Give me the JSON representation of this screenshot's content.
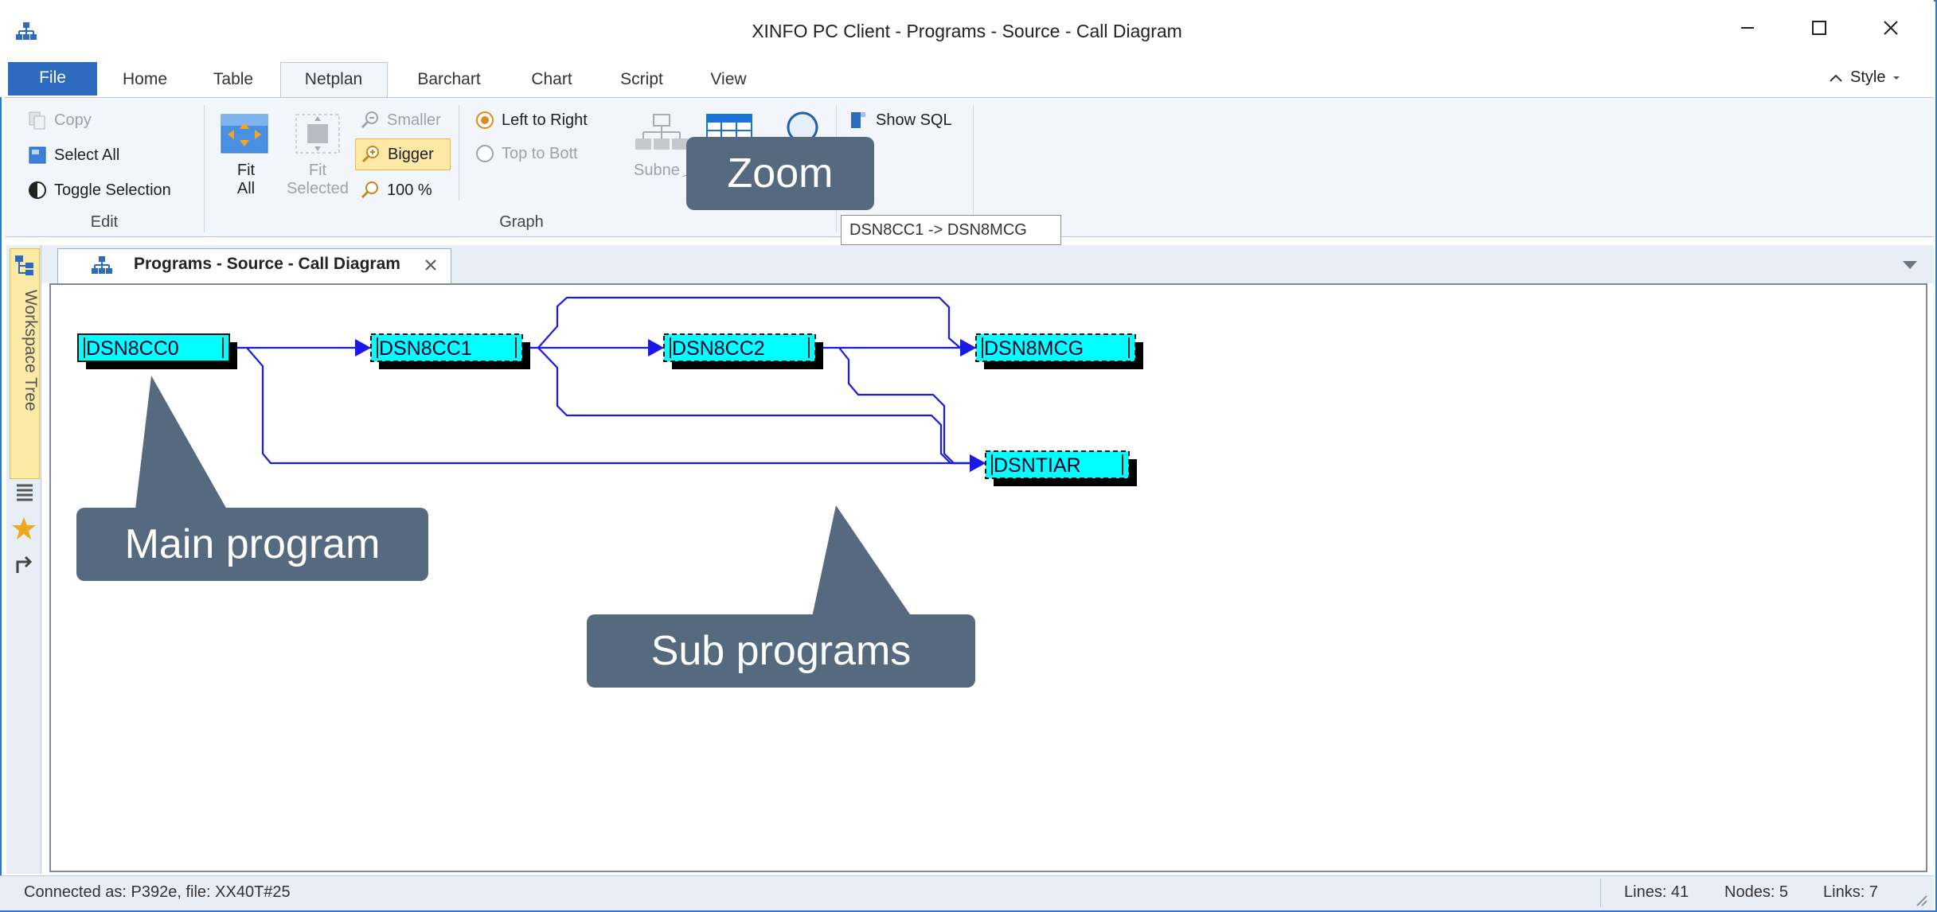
{
  "window": {
    "title": "XINFO PC Client - Programs - Source - Call Diagram"
  },
  "ribbon_tabs": [
    "File",
    "Home",
    "Table",
    "Netplan",
    "Barchart",
    "Chart",
    "Script",
    "View"
  ],
  "style_button": "Style",
  "ribbon": {
    "edit": {
      "copy": "Copy",
      "select_all": "Select All",
      "toggle_selection": "Toggle Selection",
      "label": "Edit"
    },
    "graph": {
      "fit_all_1": "Fit",
      "fit_all_2": "All",
      "fit_selected_1": "Fit",
      "fit_selected_2": "Selected",
      "smaller": "Smaller",
      "bigger": "Bigger",
      "zoom_100": "100 %",
      "left_to_right": "Left to Right",
      "top_to_bottom": "Top to Bott",
      "subnet": "Subne",
      "label": "Graph"
    },
    "show_sql": "Show SQL"
  },
  "tooltip": "DSN8CC1 -> DSN8MCG",
  "callouts": {
    "zoom": "Zoom",
    "main_program": "Main program",
    "sub_programs": "Sub programs"
  },
  "sidebar": {
    "workspace_tree": "Workspace Tree"
  },
  "document_tab": {
    "title": "Programs - Source - Call Diagram"
  },
  "diagram": {
    "nodes": [
      {
        "id": "DSN8CC0",
        "label": "DSN8CC0"
      },
      {
        "id": "DSN8CC1",
        "label": "DSN8CC1"
      },
      {
        "id": "DSN8CC2",
        "label": "DSN8CC2"
      },
      {
        "id": "DSN8MCG",
        "label": "DSN8MCG"
      },
      {
        "id": "DSNTIAR",
        "label": "DSNTIAR"
      }
    ],
    "links": [
      {
        "from": "DSN8CC0",
        "to": "DSN8CC1"
      },
      {
        "from": "DSN8CC0",
        "to": "DSNTIAR"
      },
      {
        "from": "DSN8CC1",
        "to": "DSN8CC2"
      },
      {
        "from": "DSN8CC1",
        "to": "DSN8MCG"
      },
      {
        "from": "DSN8CC1",
        "to": "DSNTIAR"
      },
      {
        "from": "DSN8CC2",
        "to": "DSN8MCG"
      },
      {
        "from": "DSN8CC2",
        "to": "DSNTIAR"
      }
    ],
    "colors": {
      "node_fill": "#00ffff",
      "link": "#1a1ae6"
    }
  },
  "status": {
    "connected": "Connected as: P392e, file: XX40T#25",
    "lines": "Lines: 41",
    "nodes": "Nodes: 5",
    "links": "Links: 7"
  }
}
